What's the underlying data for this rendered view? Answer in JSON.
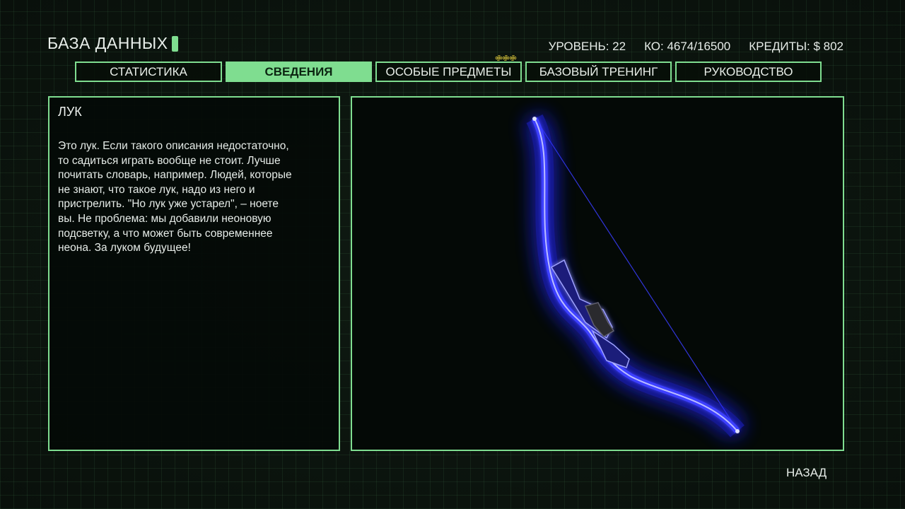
{
  "header": {
    "title": "БАЗА ДАННЫХ"
  },
  "stats": {
    "level": "УРОВЕНЬ: 22",
    "xp": "КО: 4674/16500",
    "credits": "КРЕДИТЫ: $ 802"
  },
  "tabs": [
    {
      "label": "СТАТИСТИКА",
      "active": false
    },
    {
      "label": "СВЕДЕНИЯ",
      "active": true
    },
    {
      "label": "ОСОБЫЕ ПРЕДМЕТЫ",
      "active": false,
      "new_icon": "ꗂꗂꗂ"
    },
    {
      "label": "БАЗОВЫЙ ТРЕНИНГ",
      "active": false
    },
    {
      "label": "РУКОВОДСТВО",
      "active": false
    }
  ],
  "item": {
    "name": "ЛУК",
    "description": "Это лук. Если такого описания недостаточно,\nто садиться играть вообще не стоит. Лучше\nпочитать словарь, например. Людей, которые\nне знают, что такое лук, надо из него и\nпристрелить. \"Но лук уже устарел\", – ноете\nвы. Не проблема: мы добавили неоновую\nподсветку, а что может быть современнее\nнеона. За луком будущее!",
    "image": "neon-blue-bow"
  },
  "footer": {
    "back_label": "НАЗАД"
  },
  "colors": {
    "accent": "#7fdd90",
    "background": "#0b120d",
    "neon": "#3a3dff"
  }
}
